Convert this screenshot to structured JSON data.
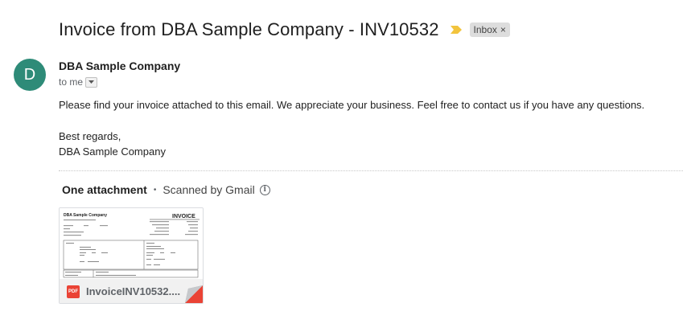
{
  "email": {
    "subject": "Invoice from DBA Sample Company - INV10532",
    "label": "Inbox",
    "label_close": "×",
    "sender_initial": "D",
    "sender_name": "DBA Sample Company",
    "recipient": "to me",
    "body_line1": "Please find your invoice attached to this email. We appreciate your business.  Feel free to contact us if you have any questions.",
    "closing": "Best regards,",
    "signature": "DBA Sample Company"
  },
  "attachments": {
    "count_label": "One attachment",
    "separator": "•",
    "scan_label": "Scanned by Gmail",
    "file": {
      "name": "InvoiceINV10532....",
      "type_badge": "PDF",
      "preview_company": "DBA Sample Company",
      "preview_title": "INVOICE"
    }
  },
  "colors": {
    "avatar": "#2e8b78",
    "importance": "#f2c43d",
    "pdf_badge": "#ea4335"
  },
  "icons": {
    "importance": "importance-marker-icon",
    "dropdown": "chevron-down-icon",
    "info": "info-icon",
    "pdf": "pdf-icon"
  }
}
